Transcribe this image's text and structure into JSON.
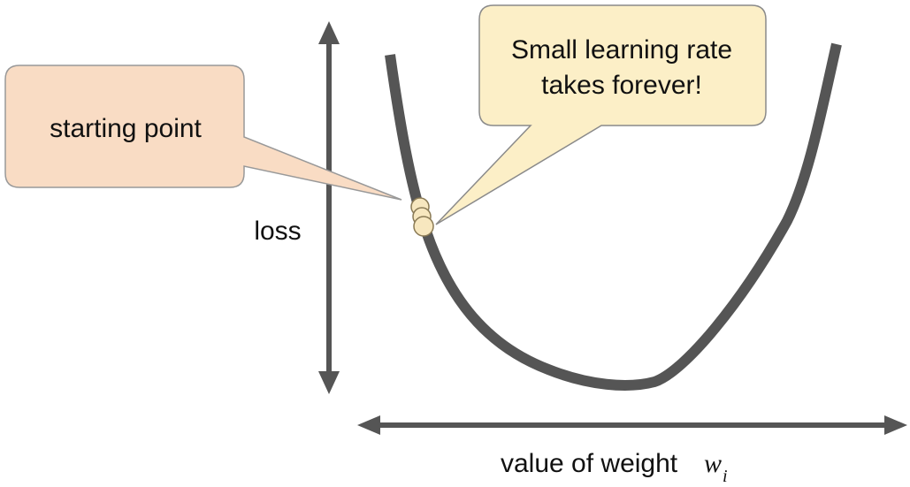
{
  "axes": {
    "y_label": "loss",
    "x_label": "value of weight",
    "x_symbol": "w",
    "x_symbol_subscript": "i"
  },
  "callouts": {
    "start": {
      "text": "starting point"
    },
    "slow": {
      "line1": "Small learning rate",
      "line2": "takes forever!"
    }
  },
  "colors": {
    "curve": "#555555",
    "axis": "#555555",
    "start_callout_fill": "#f9dcc4",
    "start_callout_stroke": "#999999",
    "slow_callout_fill": "#fcefc7",
    "slow_callout_stroke": "#8a8a8a",
    "ball_fill": "#f7e7bf",
    "ball_stroke": "#8a7a55"
  },
  "steps": {
    "count": 3
  }
}
